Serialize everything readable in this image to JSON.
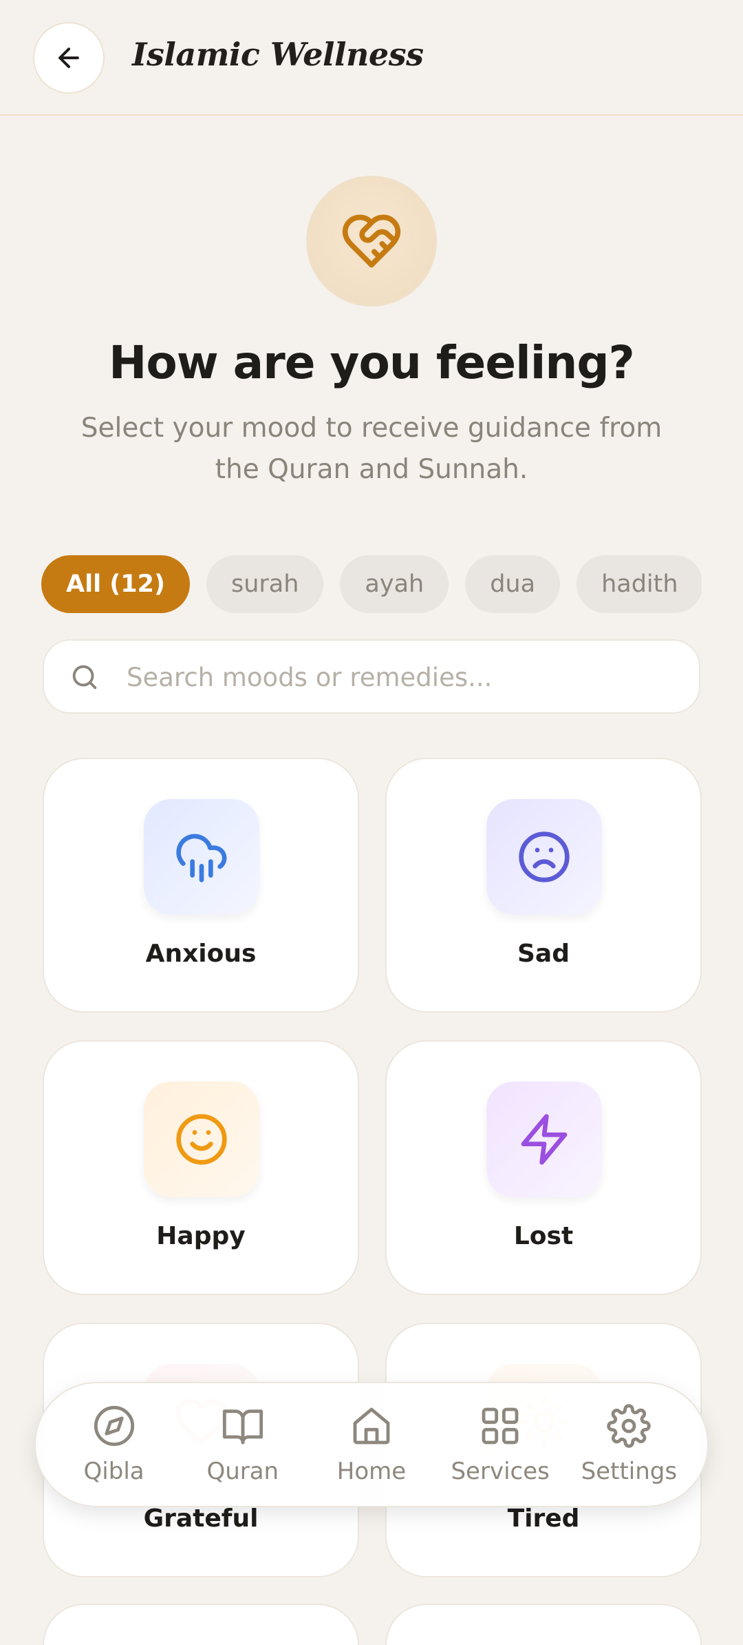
{
  "header": {
    "title": "Islamic Wellness",
    "back_icon": "arrow-left-icon"
  },
  "hero": {
    "icon": "heart-handshake-icon",
    "title": "How are you feeling?",
    "subtitle": "Select your mood to receive guidance from the Quran and Sunnah."
  },
  "filters": [
    {
      "label": "All (12)",
      "active": true
    },
    {
      "label": "surah",
      "active": false
    },
    {
      "label": "ayah",
      "active": false
    },
    {
      "label": "dua",
      "active": false
    },
    {
      "label": "hadith",
      "active": false
    },
    {
      "label": "",
      "active": false
    }
  ],
  "search": {
    "placeholder": "Search moods or remedies..."
  },
  "moods": [
    {
      "label": "Anxious",
      "icon": "cloud-rain-icon",
      "color": "#3b7be0"
    },
    {
      "label": "Sad",
      "icon": "frown-icon",
      "color": "#5c5bd6"
    },
    {
      "label": "Happy",
      "icon": "smile-icon",
      "color": "#ef9a12"
    },
    {
      "label": "Lost",
      "icon": "zap-icon",
      "color": "#9b4fe0"
    },
    {
      "label": "Grateful",
      "icon": "heart-icon",
      "color": "#e85a5a"
    },
    {
      "label": "Tired",
      "icon": "sun-icon",
      "color": "#e49a3c"
    }
  ],
  "nav": [
    {
      "label": "Qibla",
      "icon": "compass-icon"
    },
    {
      "label": "Quran",
      "icon": "book-open-icon"
    },
    {
      "label": "Home",
      "icon": "home-icon"
    },
    {
      "label": "Services",
      "icon": "grid-icon"
    },
    {
      "label": "Settings",
      "icon": "gear-icon"
    }
  ],
  "colors": {
    "accent": "#c67b12",
    "background": "#f5f2ed"
  }
}
